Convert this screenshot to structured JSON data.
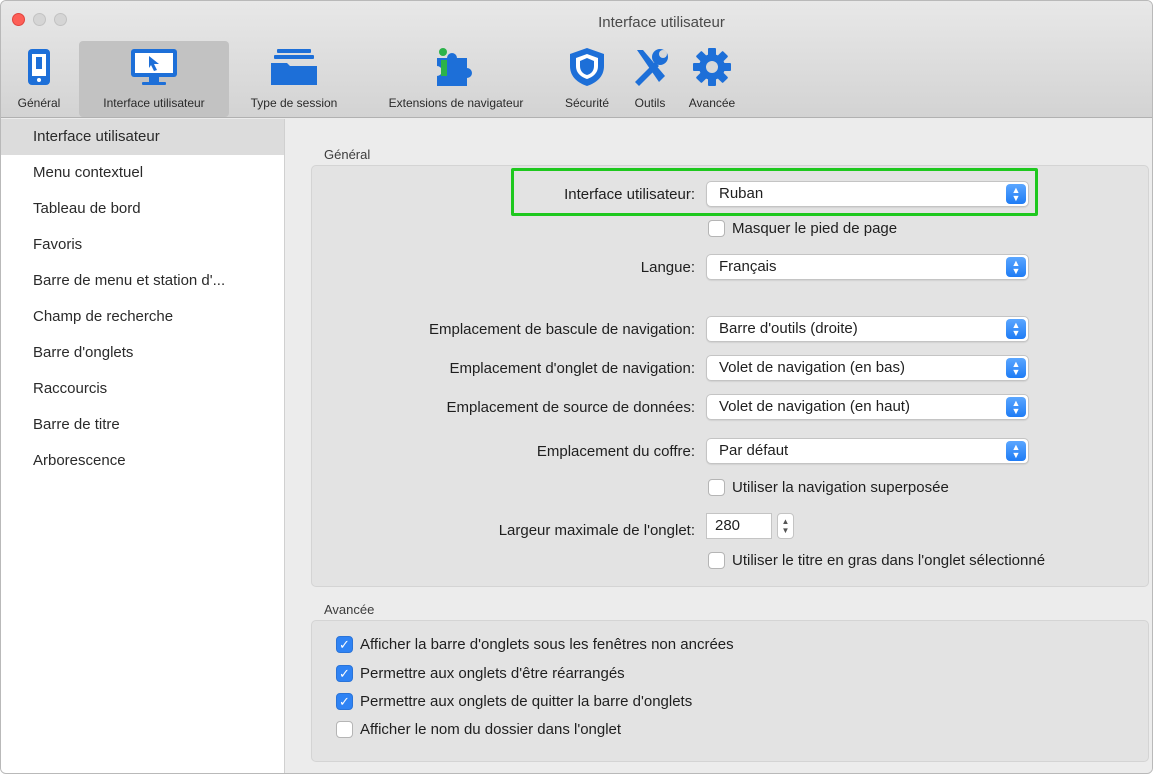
{
  "window": {
    "title": "Interface utilisateur"
  },
  "toolbar": {
    "items": [
      {
        "label": "Général",
        "icon": "phone-icon"
      },
      {
        "label": "Interface utilisateur",
        "icon": "monitor-cursor-icon",
        "selected": true
      },
      {
        "label": "Type de session",
        "icon": "folders-icon"
      },
      {
        "label": "Extensions de navigateur",
        "icon": "puzzle-icon"
      },
      {
        "label": "Sécurité",
        "icon": "shield-icon"
      },
      {
        "label": "Outils",
        "icon": "tools-icon"
      },
      {
        "label": "Avancée",
        "icon": "gear-icon"
      }
    ]
  },
  "sidebar": {
    "items": [
      {
        "label": "Interface utilisateur",
        "active": true
      },
      {
        "label": "Menu contextuel"
      },
      {
        "label": "Tableau de bord"
      },
      {
        "label": "Favoris"
      },
      {
        "label": "Barre de menu et station d'..."
      },
      {
        "label": "Champ de recherche"
      },
      {
        "label": "Barre d'onglets"
      },
      {
        "label": "Raccourcis"
      },
      {
        "label": "Barre de titre"
      },
      {
        "label": "Arborescence"
      }
    ]
  },
  "general": {
    "title": "Général",
    "ui_label": "Interface utilisateur:",
    "ui_value": "Ruban",
    "hide_footer": "Masquer le pied de page",
    "lang_label": "Langue:",
    "lang_value": "Français",
    "toggle_label": "Emplacement de bascule de navigation:",
    "toggle_value": "Barre d'outils (droite)",
    "tab_label": "Emplacement d'onglet de navigation:",
    "tab_value": "Volet de navigation (en bas)",
    "source_label": "Emplacement de source de données:",
    "source_value": "Volet de navigation (en haut)",
    "vault_label": "Emplacement du coffre:",
    "vault_value": "Par défaut",
    "overlay_nav": "Utiliser la navigation superposée",
    "maxwidth_label": "Largeur maximale de l'onglet:",
    "maxwidth_value": "280",
    "bold_title": "Utiliser le titre en gras dans l'onglet sélectionné"
  },
  "advanced": {
    "title": "Avancée",
    "options": [
      {
        "label": "Afficher la barre d'onglets sous les fenêtres non ancrées",
        "checked": true
      },
      {
        "label": "Permettre aux onglets d'être réarrangés",
        "checked": true
      },
      {
        "label": "Permettre aux onglets de quitter la barre d'onglets",
        "checked": true
      },
      {
        "label": "Afficher le nom du dossier dans l'onglet",
        "checked": false
      }
    ]
  },
  "colors": {
    "accent": "#2f83f4",
    "highlight": "#1ec81e"
  }
}
